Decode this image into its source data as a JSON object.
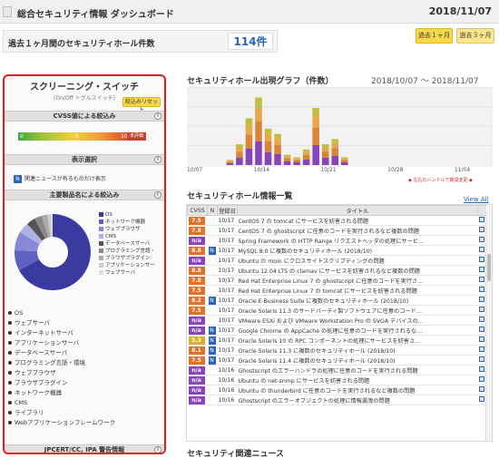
{
  "header": {
    "title": "総合セキュリティ情報 ダッシュボード",
    "date": "2018/11/07"
  },
  "summary": {
    "label": "過去１ヶ月間のセキュリティホール件数",
    "count": "114件"
  },
  "period_buttons": [
    {
      "label": "過去１ヶ月"
    },
    {
      "label": "過去３ヶ月"
    }
  ],
  "sidebar": {
    "title": "スクリーニング・スイッチ",
    "subtitle": "(On/Off トグルスイッチ)",
    "reset_label": "絞込みリセット",
    "cvss_head": "CVSS値による絞込み",
    "cvss_ticks": [
      "0",
      "5",
      "10"
    ],
    "cvss_unrated": "未評価",
    "display_head": "表示選択",
    "news_checkbox": "関連ニュースが有るものだけ表示",
    "product_head": "主要製品名による絞込み",
    "legend": [
      {
        "label": "OS",
        "color": "#3a3aa0"
      },
      {
        "label": "ネットワーク機器",
        "color": "#6060c0"
      },
      {
        "label": "ウェブブラウザ",
        "color": "#8888d8"
      },
      {
        "label": "CMS",
        "color": "#b0b0e8"
      },
      {
        "label": "データベースサーバ",
        "color": "#555555"
      },
      {
        "label": "プログラミング言語・",
        "color": "#888888"
      },
      {
        "label": "ブラウザプラグイン",
        "color": "#aaaaaa"
      },
      {
        "label": "アプリケーションサー",
        "color": "#cccccc"
      },
      {
        "label": "ウェブサーバ",
        "color": "#dddddd"
      }
    ],
    "categories": [
      "OS",
      "ウェブサーバ",
      "インターネットサーバ",
      "アプリケーションサーバ",
      "データベースサーバ",
      "プログラミング言語・環境",
      "ウェブブラウザ",
      "ブラウザプラグイン",
      "ネットワーク機器",
      "CMS",
      "ライブラリ",
      "Webアプリケーションフレームワーク"
    ],
    "jpcert_head": "JPCERT/CC, IPA 警告情報"
  },
  "graph": {
    "title": "セキュリティホール出現グラフ（件数）",
    "range": "2018/10/07 ～ 2018/11/07",
    "note": "◆ 左右のハンドルで期間変更 ◆"
  },
  "chart_data": {
    "type": "bar",
    "x_ticks": [
      "10/07",
      "10/14",
      "10/21",
      "10/28",
      "11/04"
    ],
    "ylim": [
      0,
      30
    ],
    "values": [
      0,
      0,
      0,
      0,
      2,
      8,
      18,
      26,
      14,
      12,
      4,
      3,
      6,
      22,
      8,
      10,
      3,
      0,
      0,
      0,
      0,
      0,
      0,
      0,
      0,
      0,
      0,
      0,
      0,
      0,
      0,
      0
    ]
  },
  "vuln_table": {
    "title": "セキュリティホール情報一覧",
    "view_all": "View All",
    "headers": {
      "cvss": "CVSS",
      "n": "N",
      "date": "登録日",
      "title": "タイトル"
    },
    "rows": [
      {
        "cvss": "7.5",
        "n": "",
        "date": "10/17",
        "title": "CentOS 7 の tomcat にサービスを妨害される問題"
      },
      {
        "cvss": "7.8",
        "n": "",
        "date": "10/17",
        "title": "CentOS 7 の ghostscript に任意のコードを実行されるなど複数の問題"
      },
      {
        "cvss": "n/a",
        "n": "",
        "date": "10/17",
        "title": "Spring Framework の HTTP Range リクエストヘッダの処理にサービ…"
      },
      {
        "cvss": "8.8",
        "n": "N",
        "date": "10/17",
        "title": "MySQL 8.0 に複数のセキュリティホール (2018/10)"
      },
      {
        "cvss": "n/a",
        "n": "",
        "date": "10/17",
        "title": "Ubuntu の moin にクロスサイトスクリプティングの問題"
      },
      {
        "cvss": "8.8",
        "n": "",
        "date": "10/17",
        "title": "Ubuntu 12.04 LTS の clamav にサービスを妨害されるなど複数の問題"
      },
      {
        "cvss": "7.8",
        "n": "",
        "date": "10/17",
        "title": "Red Hat Enterprise Linux 7 の ghostscript に任意のコードを実行さ…"
      },
      {
        "cvss": "7.5",
        "n": "",
        "date": "10/17",
        "title": "Red Hat Enterprise Linux 7 の tomcat にサービスを妨害される問題"
      },
      {
        "cvss": "8.2",
        "n": "N",
        "date": "10/17",
        "title": "Oracle E-Business Suite に複数のセキュリティホール (2018/10)"
      },
      {
        "cvss": "7.5",
        "n": "",
        "date": "10/17",
        "title": "Oracle Solaris 11.3 のサードパーティ製ソフトウェアに任意のコード…"
      },
      {
        "cvss": "n/a",
        "n": "",
        "date": "10/17",
        "title": "VMware ESXi および VMware Workstation Pro の SVGA デバイスの…"
      },
      {
        "cvss": "n/a",
        "n": "N",
        "date": "10/17",
        "title": "Google Chrome の AppCache の処理に任意のコードを実行されるな…"
      },
      {
        "cvss": "5.3",
        "n": "N",
        "date": "10/17",
        "title": "Oracle Solaris 10 の RPC コンポーネントの処理にサービスを妨害さ…"
      },
      {
        "cvss": "8.1",
        "n": "N",
        "date": "10/17",
        "title": "Oracle Solaris 11.3 に複数のセキュリティホール (2018/10)"
      },
      {
        "cvss": "7.5",
        "n": "N",
        "date": "10/17",
        "title": "Oracle Solaris 11.4 に複数のセキュリティホール (2018/10)"
      },
      {
        "cvss": "n/a",
        "n": "",
        "date": "10/16",
        "title": "Ghostscript のエラーハンドラの処理に任意のコードを実行される問題"
      },
      {
        "cvss": "n/a",
        "n": "",
        "date": "10/16",
        "title": "Ubuntu の net-snmp にサービスを妨害される問題"
      },
      {
        "cvss": "n/a",
        "n": "",
        "date": "10/16",
        "title": "Ubuntu の thunderbird に任意のコードを実行されるなど複数の問題"
      },
      {
        "cvss": "n/a",
        "n": "",
        "date": "10/16",
        "title": "Ghostscript のエラーオブジェクトの処理に情報漏洩の問題"
      }
    ]
  },
  "news_section": {
    "title": "セキュリティ関連ニュース"
  }
}
